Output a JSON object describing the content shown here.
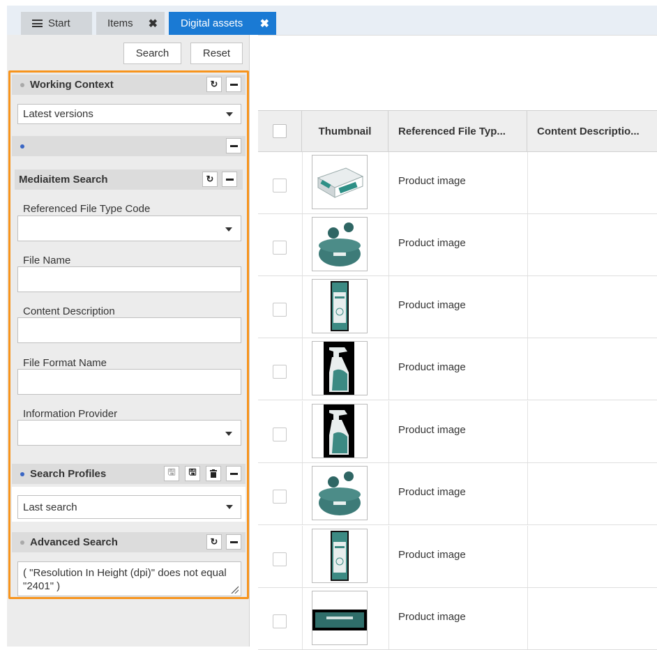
{
  "tabs": [
    {
      "label": "Start"
    },
    {
      "label": "Items"
    },
    {
      "label": "Digital assets"
    }
  ],
  "colors": {
    "accent": "#1a7ad4",
    "highlight_frame": "#f7941d"
  },
  "toolbar": {
    "search_label": "Search",
    "reset_label": "Reset"
  },
  "working_context": {
    "title": "Working Context",
    "selected": "Latest versions"
  },
  "mediaitem_search": {
    "title": "Mediaitem Search",
    "fields": [
      {
        "label": "Referenced File Type Code",
        "value": ""
      },
      {
        "label": "File Name",
        "value": ""
      },
      {
        "label": "Content Description",
        "value": ""
      },
      {
        "label": "File Format Name",
        "value": ""
      },
      {
        "label": "Information Provider",
        "value": ""
      }
    ]
  },
  "search_profiles": {
    "title": "Search Profiles",
    "selected": "Last search"
  },
  "advanced_search": {
    "title": "Advanced Search",
    "query": "( \"Resolution In Height (dpi)\" does not equal \"2401\"  )"
  },
  "grid": {
    "columns": [
      "Thumbnail",
      "Referenced File Typ...",
      "Content Descriptio..."
    ],
    "rows": [
      {
        "thumbnail": "gloves-box",
        "file_type": "Product image",
        "content_description": ""
      },
      {
        "thumbnail": "earbuds-case",
        "file_type": "Product image",
        "content_description": ""
      },
      {
        "thumbnail": "package-tube",
        "file_type": "Product image",
        "content_description": ""
      },
      {
        "thumbnail": "spray-bottle",
        "file_type": "Product image",
        "content_description": ""
      },
      {
        "thumbnail": "spray-bottle",
        "file_type": "Product image",
        "content_description": ""
      },
      {
        "thumbnail": "earbuds-case",
        "file_type": "Product image",
        "content_description": ""
      },
      {
        "thumbnail": "package-tube",
        "file_type": "Product image",
        "content_description": ""
      },
      {
        "thumbnail": "bar-wrapper",
        "file_type": "Product image",
        "content_description": ""
      }
    ]
  }
}
